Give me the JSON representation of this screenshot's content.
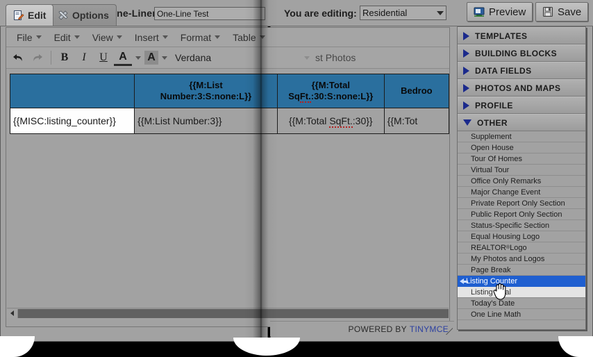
{
  "tabs": {
    "edit": {
      "label": "Edit",
      "icon": "document-edit-icon"
    },
    "options": {
      "label": "Options",
      "icon": "tools-icon"
    }
  },
  "oneliner": {
    "label": "One-Liner:",
    "value": "One-Line Test",
    "placeholder": "One-Line Test"
  },
  "editing": {
    "label": "You are editing:",
    "value": "Residential"
  },
  "buttons": {
    "preview": {
      "label": "Preview",
      "icon": "preview-monitor-icon"
    },
    "save": {
      "label": "Save",
      "icon": "floppy-disk-icon"
    }
  },
  "editor": {
    "menu": [
      "File",
      "Edit",
      "View",
      "Insert",
      "Format",
      "Table"
    ],
    "toolbar": {
      "undo": "undo-arrow-icon",
      "redo": "redo-arrow-icon",
      "bold": "B",
      "italic": "I",
      "underline": "U",
      "forecolor": "A",
      "backcolor": "A",
      "fontname": "Verdana",
      "fontsize_partial": "st Photos"
    },
    "table": {
      "header_row": [
        "",
        "{{M:List Number:3:S:none:L}}",
        "{{M:Total SqFt.:30:S:none:L}}",
        "Bedroo"
      ],
      "body_row": [
        "{{MISC:listing_counter}}",
        "{{M:List Number:3}}",
        "{{M:Total SqFt.:30}}",
        "{{M:Tot"
      ]
    }
  },
  "statusbar": {
    "powered_by": "POWERED BY",
    "brand": "TINYMCE"
  },
  "sidebar": {
    "sections": [
      {
        "label": "TEMPLATES",
        "expanded": false
      },
      {
        "label": "BUILDING BLOCKS",
        "expanded": false
      },
      {
        "label": "DATA FIELDS",
        "expanded": false
      },
      {
        "label": "PHOTOS AND MAPS",
        "expanded": false
      },
      {
        "label": "PROFILE",
        "expanded": false
      },
      {
        "label": "OTHER",
        "expanded": true
      }
    ],
    "other_items": [
      {
        "label": "Supplement",
        "state": "normal"
      },
      {
        "label": "Open House",
        "state": "normal"
      },
      {
        "label": "Tour Of Homes",
        "state": "normal"
      },
      {
        "label": "Virtual Tour",
        "state": "normal"
      },
      {
        "label": "Office Only Remarks",
        "state": "normal"
      },
      {
        "label": "Major Change Event",
        "state": "normal"
      },
      {
        "label": "Private Report Only Section",
        "state": "normal"
      },
      {
        "label": "Public Report Only Section",
        "state": "normal"
      },
      {
        "label": "Status-Specific Section",
        "state": "normal"
      },
      {
        "label": "Equal Housing Logo",
        "state": "normal"
      },
      {
        "label": "REALTOR",
        "suffix": " Logo",
        "superscript": "®",
        "state": "normal"
      },
      {
        "label": "My Photos and Logos",
        "state": "normal"
      },
      {
        "label": "Page Break",
        "state": "normal"
      },
      {
        "label": "Listing Counter",
        "state": "selected"
      },
      {
        "label": "Listing Total",
        "state": "hover"
      },
      {
        "label": "Today's Date",
        "state": "normal"
      },
      {
        "label": "One Line Math",
        "state": "normal"
      }
    ]
  },
  "colors": {
    "table_header_blue": "#2a6f9e",
    "selection_blue": "#1f5fd0",
    "panel_gray": "#a2a2a2",
    "brand_link": "#2b3fa0"
  }
}
